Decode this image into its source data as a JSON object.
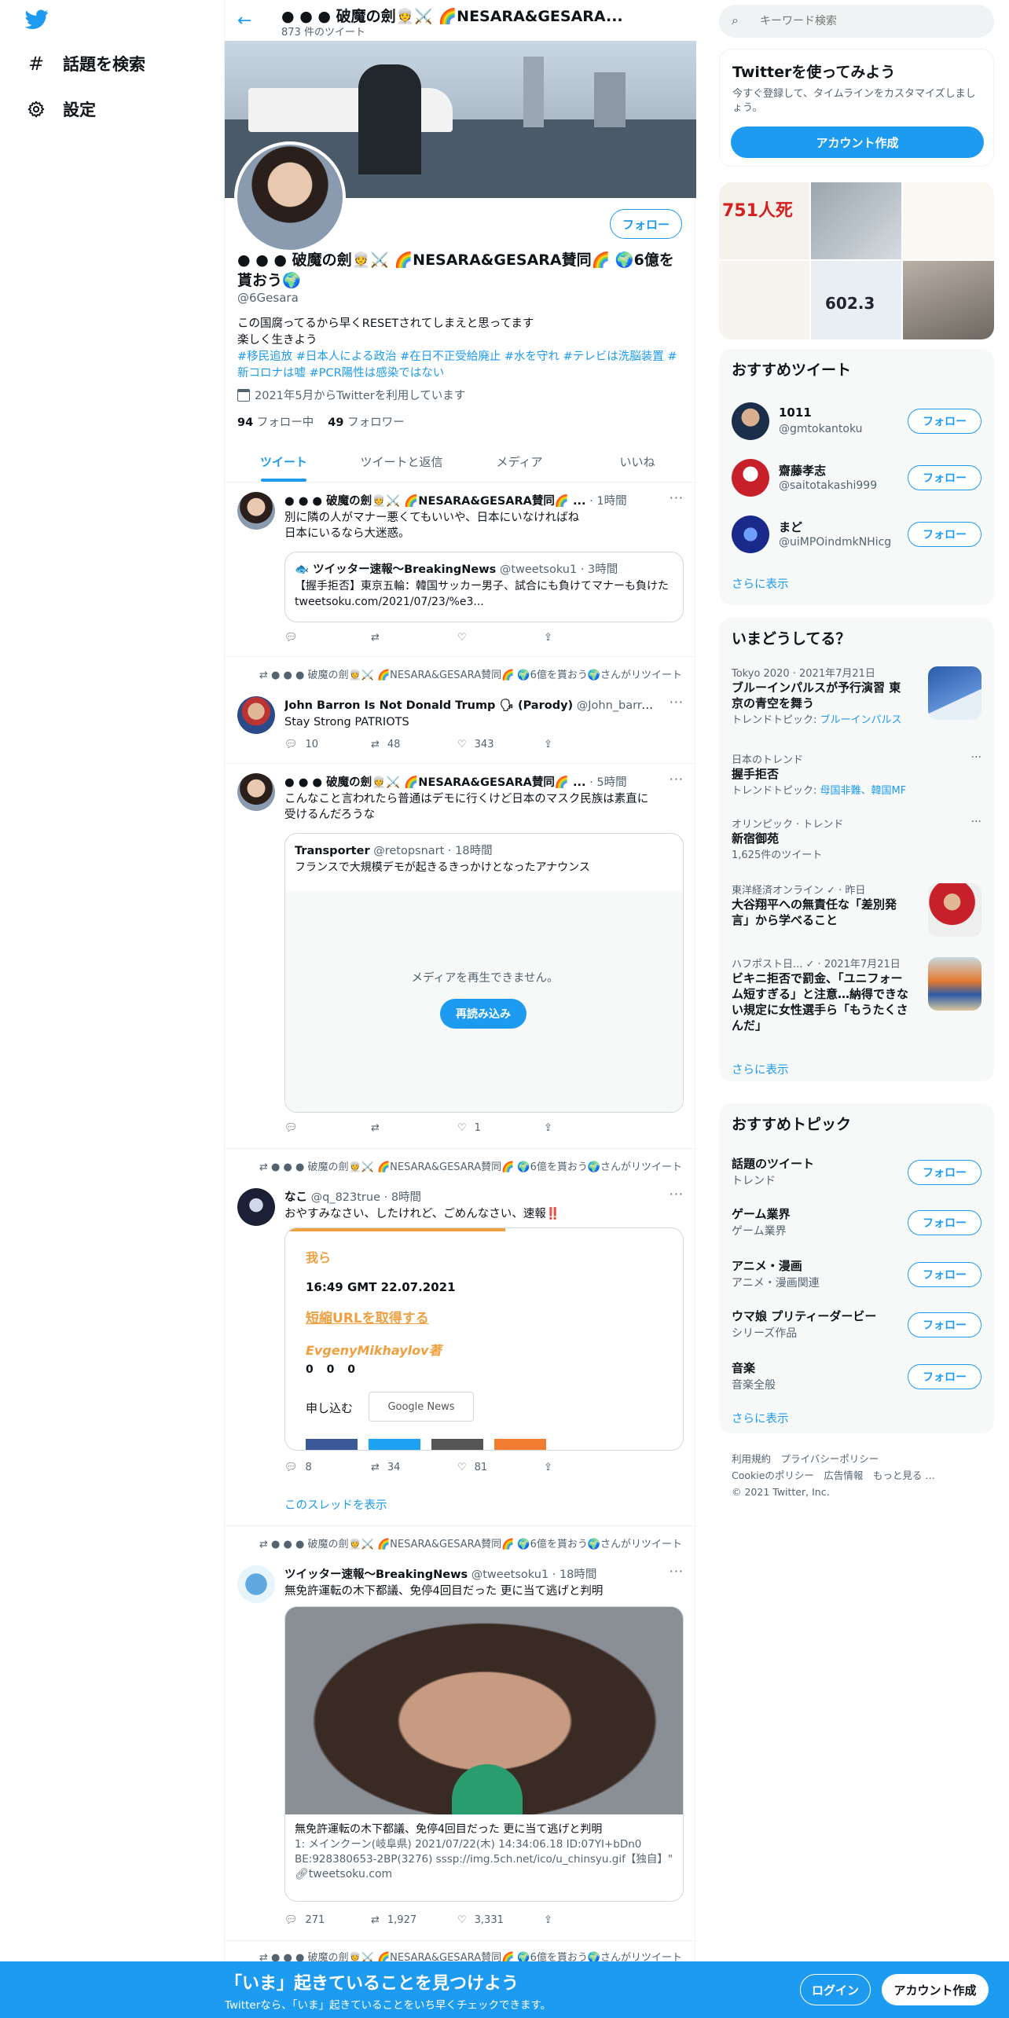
{
  "nav": {
    "explore": "話題を検索",
    "settings": "設定"
  },
  "header": {
    "title": "● ● ● 破魔の劍👳⚔️ 🌈NESARA&GESARA...",
    "tweet_count": "873 件のツイート"
  },
  "profile": {
    "follow_label": "フォロー",
    "name": "● ● ● 破魔の劍👳⚔️ 🌈NESARA&GESARA賛同🌈 🌍6億を貰おう🌍",
    "handle": "@6Gesara",
    "bio_line1": "この国腐ってるから早くRESETされてしまえと思ってます",
    "bio_line2": "楽しく生きよう",
    "hashtags": "#移民追放 #日本人による政治 #在日不正受給廃止 #水を守れ #テレビは洗脳装置 #新コロナは嘘 #PCR陽性は感染ではない",
    "joined": "2021年5月からTwitterを利用しています",
    "following_count": "94",
    "following_label": "フォロー中",
    "followers_count": "49",
    "followers_label": "フォロワー"
  },
  "tabs": [
    "ツイート",
    "ツイートと返信",
    "メディア",
    "いいね"
  ],
  "tweets": [
    {
      "author": "● ● ● 破魔の劍👳⚔️ 🌈NESARA&GESARA賛同🌈 ...",
      "time": "· 1時間",
      "text": "別に隣の人がマナー悪くてもいいや、日本にいなければね\n日本にいるなら大迷惑。",
      "quote_author": "🐟 ツイッター速報〜BreakingNews",
      "quote_handle": "@tweetsoku1 · 3時間",
      "quote_text": "【握手拒否】東京五輪：韓国サッカー男子、試合にも負けてマナーも負けた tweetsoku.com/2021/07/23/%e3..."
    },
    {
      "rt_note": "● ● ● 破魔の劍👳⚔️ 🌈NESARA&GESARA賛同🌈 🌍6億を貰おう🌍さんがリツイート",
      "author": "John Barron Is Not Donald Trump 🗣 (Parody)",
      "handle_time": "@John_barro... · 2時間",
      "text": "Stay Strong PATRIOTS",
      "replies": "10",
      "retweets": "48",
      "likes": "343"
    },
    {
      "author": "● ● ● 破魔の劍👳⚔️ 🌈NESARA&GESARA賛同🌈 ...",
      "time": "· 5時間",
      "text": "こんなこと言われたら普通はデモに行くけど日本のマスク民族は素直に受けるんだろうな",
      "quote_author": "Transporter",
      "quote_handle": "@retopsnart · 18時間",
      "quote_text": "フランスで大規模デモが起きるきっかけとなったアナウンス",
      "media_error": "メディアを再生できません。",
      "reload": "再読み込み",
      "likes": "1"
    },
    {
      "rt_note": "● ● ● 破魔の劍👳⚔️ 🌈NESARA&GESARA賛同🌈 🌍6億を貰おう🌍さんがリツイート",
      "author": "なこ",
      "handle_time": "@q_823true · 8時間",
      "text": "おやすみなさい、したけれど、ごめんなさい、速報‼️",
      "card_line1": "我ら",
      "card_line2": "16:49 GMT 22.07.2021",
      "card_line3": "短縮URLを取得する",
      "card_line4": "EvgenyMikhaylov著",
      "card_counts": "0   0   0",
      "card_subscribe": "申し込む",
      "card_gnews": "Google News",
      "replies": "8",
      "retweets": "34",
      "likes": "81",
      "show_thread": "このスレッドを表示"
    },
    {
      "rt_note": "● ● ● 破魔の劍👳⚔️ 🌈NESARA&GESARA賛同🌈 🌍6億を貰おう🌍さんがリツイート",
      "author": "ツイッター速報〜BreakingNews",
      "handle_time": "@tweetsoku1 · 18時間",
      "text": "無免許運転の木下都議、免停4回目だった 更に当て逃げと判明",
      "link_title": "無免許運転の木下都議、免停4回目だった 更に当て逃げと判明",
      "link_desc": "1: メインクーン(岐阜県) 2021/07/22(木) 14:34:06.18 ID:07YI+bDn0 BE:928380653-2BP(3276) sssp://img.5ch.net/ico/u_chinsyu.gif【独自】\"",
      "link_domain": "tweetsoku.com",
      "replies": "271",
      "retweets": "1,927",
      "likes": "3,331"
    },
    {
      "rt_note": "● ● ● 破魔の劍👳⚔️ 🌈NESARA&GESARA賛同🌈 🌍6億を貰おう🌍さんがリツイート"
    }
  ],
  "search": {
    "placeholder": "キーワード検索"
  },
  "signup": {
    "title": "Twitterを使ってみよう",
    "desc": "今すぐ登録して、タイムラインをカスタマイズしましょう。",
    "button": "アカウント作成"
  },
  "media_grid": {
    "text_751": "751人死",
    "text_602": "602.3"
  },
  "who_to_follow": {
    "title": "おすすめツイート",
    "users": [
      {
        "name": "1011",
        "handle": "@gmtokantoku",
        "button": "フォロー"
      },
      {
        "name": "齋藤孝志",
        "handle": "@saitotakashi999",
        "button": "フォロー"
      },
      {
        "name": "まど",
        "handle": "@uiMPOindmkNHicg",
        "button": "フォロー"
      }
    ],
    "more": "さらに表示"
  },
  "trends": {
    "title": "いまどうしてる？",
    "items": [
      {
        "meta": "Tokyo 2020 · 2021年7月21日",
        "title": "ブルーインパルスが予行演習 東京の青空を舞う",
        "sub_prefix": "トレンドトピック: ",
        "sub_link": "ブルーインパルス"
      },
      {
        "meta": "日本のトレンド",
        "title": "握手拒否",
        "sub_prefix": "トレンドトピック: ",
        "sub_link": "母国非難、韓国MF"
      },
      {
        "meta": "オリンピック · トレンド",
        "title": "新宿御苑",
        "sub_prefix": "1,625件のツイート",
        "sub_link": ""
      },
      {
        "meta": "東洋経済オンライン ✓ · 昨日",
        "title": "大谷翔平への無責任な「差別発言」から学べること",
        "sub_prefix": "",
        "sub_link": ""
      },
      {
        "meta": "ハフポスト日... ✓ · 2021年7月21日",
        "title": "ビキニ拒否で罰金、「ユニフォーム短すぎる」と注意…納得できない規定に女性選手ら「もうたくさんだ」",
        "sub_prefix": "",
        "sub_link": ""
      }
    ],
    "more": "さらに表示"
  },
  "topics": {
    "title": "おすすめトピック",
    "items": [
      {
        "name": "話題のツイート",
        "sub": "トレンド",
        "button": "フォロー"
      },
      {
        "name": "ゲーム業界",
        "sub": "ゲーム業界",
        "button": "フォロー"
      },
      {
        "name": "アニメ・漫画",
        "sub": "アニメ・漫画関連",
        "button": "フォロー"
      },
      {
        "name": "ウマ娘 プリティーダービー",
        "sub": "シリーズ作品",
        "button": "フォロー"
      },
      {
        "name": "音楽",
        "sub": "音楽全般",
        "button": "フォロー"
      }
    ],
    "more": "さらに表示"
  },
  "footer": {
    "line1": "利用規約　プライバシーポリシー",
    "line2": "Cookieのポリシー　広告情報　もっと見る …",
    "line3": "© 2021 Twitter, Inc."
  },
  "bottombar": {
    "title": "「いま」起きていることを見つけよう",
    "sub": "Twitterなら、「いま」起きていることをいち早くチェックできます。",
    "login": "ログイン",
    "signup": "アカウント作成"
  }
}
